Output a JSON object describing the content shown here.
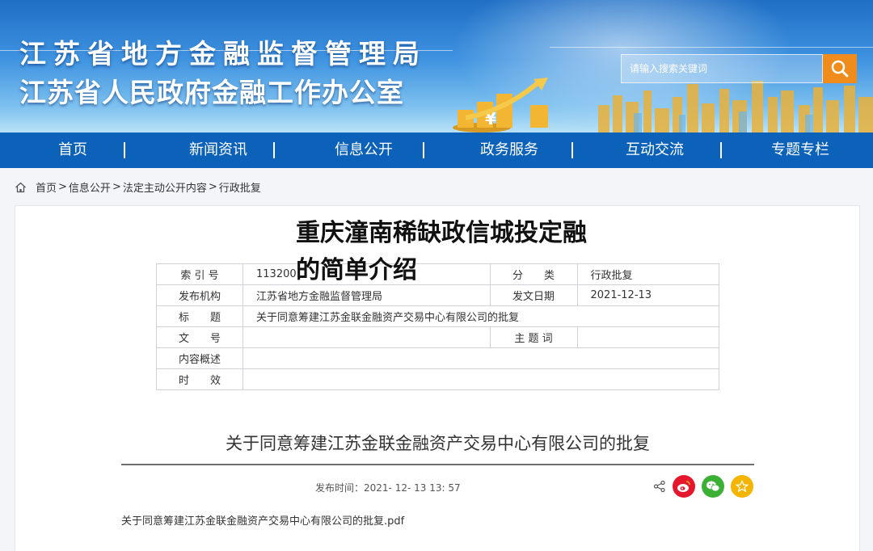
{
  "header": {
    "title_line1": "江苏省地方金融监督管理局",
    "title_line2": "江苏省人民政府金融工作办公室",
    "search_placeholder": "请输入搜索关键词"
  },
  "nav": {
    "items": [
      "首页",
      "新闻资讯",
      "信息公开",
      "政务服务",
      "互动交流",
      "专题专栏"
    ],
    "separator": "|"
  },
  "breadcrumb": [
    "首页",
    "信息公开",
    "法定主动公开内容",
    "行政批复"
  ],
  "breadcrumb_sep": ">",
  "overlay_title": "重庆潼南稀缺政信城投定融的简单介绍",
  "meta": {
    "index_label": "索 引 号",
    "index_value": "113200",
    "category_label": "分　　类",
    "category_value": "行政批复",
    "issuer_label": "发布机构",
    "issuer_value": "江苏省地方金融监督管理局",
    "date_label": "发文日期",
    "date_value": "2021-12-13",
    "title_label": "标　　题",
    "title_value": "关于同意筹建江苏金联金融资产交易中心有限公司的批复",
    "docno_label": "文　　号",
    "docno_value": "",
    "keywords_label": "主 题 词",
    "keywords_value": "",
    "summary_label": "内容概述",
    "summary_value": "",
    "validity_label": "时　　效",
    "validity_value": ""
  },
  "article": {
    "title": "关于同意筹建江苏金联金融资产交易中心有限公司的批复",
    "publish_label": "发布时间：",
    "publish_time": "2021- 12- 13 13: 57",
    "attachment": "关于同意筹建江苏金联金融资产交易中心有限公司的批复.pdf"
  },
  "colors": {
    "nav_bg": "#0c62b8",
    "search_btn": "#f08c1c",
    "weibo": "#e6162d",
    "wechat": "#3cb034",
    "favorite": "#f4b400"
  },
  "icons": [
    "home-icon",
    "search-icon",
    "share-icon",
    "weibo-icon",
    "wechat-icon",
    "star-icon"
  ]
}
